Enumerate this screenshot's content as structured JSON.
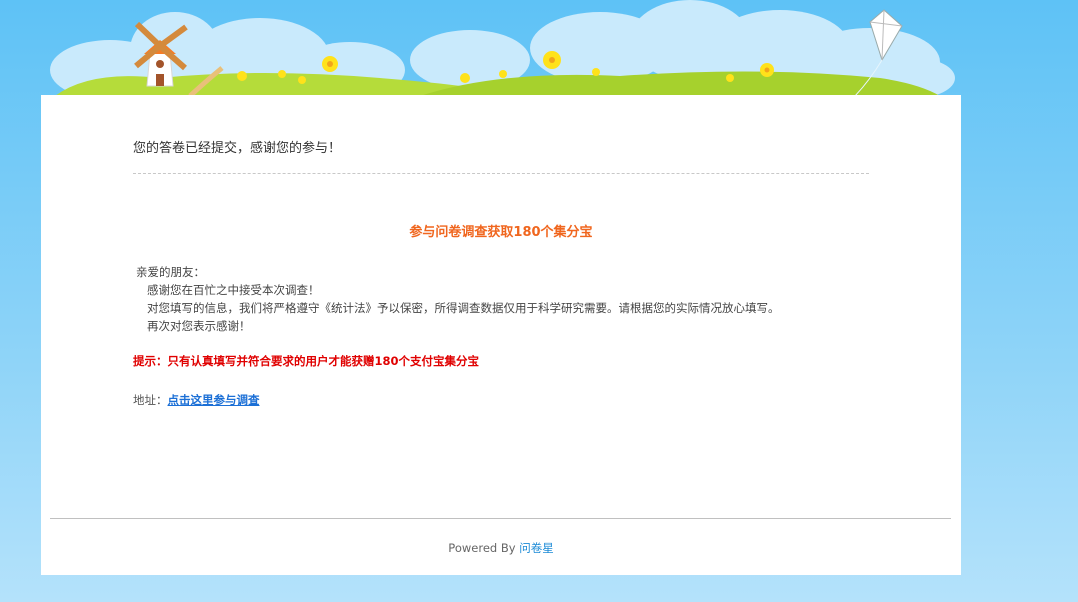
{
  "confirmation": {
    "message": "您的答卷已经提交，感谢您的参与！"
  },
  "survey": {
    "title": "参与问卷调查获取180个集分宝",
    "greeting": "亲爱的朋友：",
    "lines": [
      "感谢您在百忙之中接受本次调查！",
      "对您填写的信息，我们将严格遵守《统计法》予以保密，所得调查数据仅用于科学研究需要。请根据您的实际情况放心填写。",
      "再次对您表示感谢！"
    ],
    "tip": "提示：只有认真填写并符合要求的用户才能获赠180个支付宝集分宝",
    "address_label": "地址：",
    "address_link": "点击这里参与调查"
  },
  "footer": {
    "powered_prefix": "Powered By ",
    "brand": "问卷星"
  },
  "colors": {
    "sky": "#5ec2f6",
    "grass": "#a6d12d",
    "title_orange": "#f0661e",
    "tip_red": "#e00000",
    "link_blue": "#1b6fd6"
  }
}
